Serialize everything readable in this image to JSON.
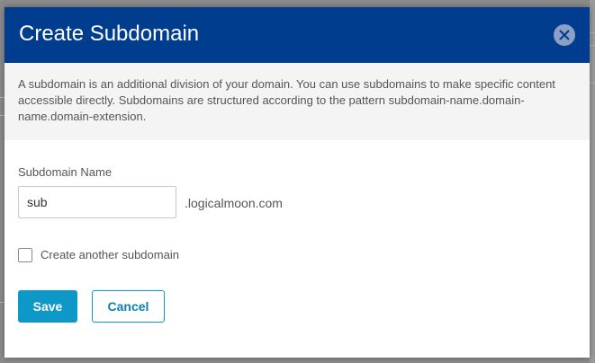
{
  "dialog": {
    "title": "Create Subdomain",
    "close_icon": "close-icon",
    "description": "A subdomain is an additional division of your domain. You can use subdomains to make specific content accessible directly. Subdomains are structured according to the pattern subdomain-name.domain-name.domain-extension.",
    "form": {
      "subdomain_label": "Subdomain Name",
      "subdomain_value": "sub",
      "domain_suffix": ".logicalmoon.com",
      "create_another_label": "Create another subdomain",
      "create_another_checked": false
    },
    "buttons": {
      "save_label": "Save",
      "cancel_label": "Cancel"
    }
  },
  "colors": {
    "header_bg": "#003d8f",
    "primary_button": "#0d98c8",
    "description_bg": "#f4f4f4"
  }
}
